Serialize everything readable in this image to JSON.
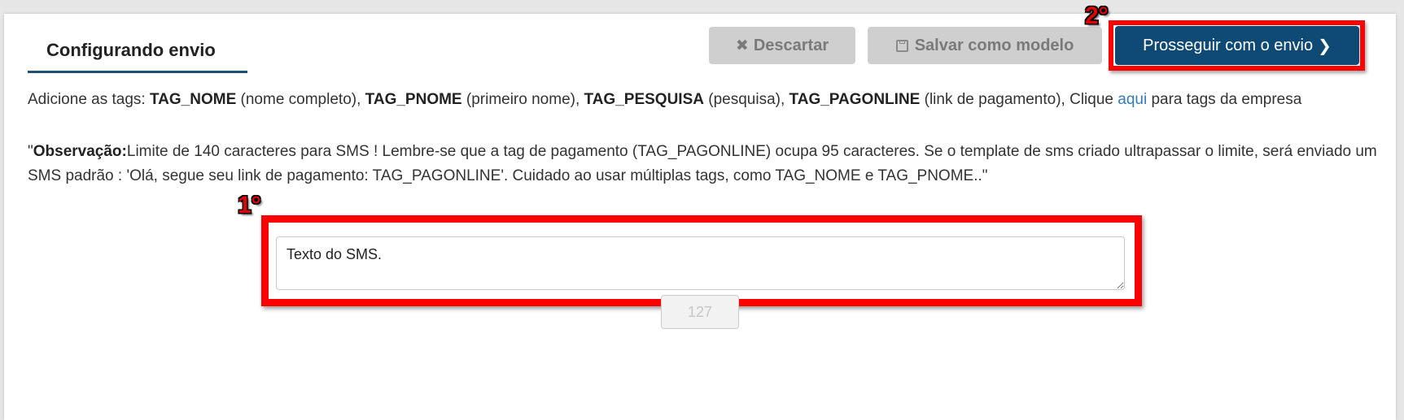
{
  "header": {
    "tab_title": "Configurando envio",
    "discard_label": "Descartar",
    "save_template_label": "Salvar como modelo",
    "proceed_label": "Prosseguir com o envio"
  },
  "annotations": {
    "step_1": "1°",
    "step_2": "2°",
    "highlight_color": "#ff0000"
  },
  "tags_line": {
    "prefix": "Adicione as tags: ",
    "tag1": "TAG_NOME",
    "tag1_desc": " (nome completo), ",
    "tag2": "TAG_PNOME",
    "tag2_desc": " (primeiro nome), ",
    "tag3": "TAG_PESQUISA",
    "tag3_desc": " (pesquisa), ",
    "tag4": "TAG_PAGONLINE",
    "tag4_desc": " (link de pagamento), Clique ",
    "link": "aqui",
    "suffix": " para tags da empresa"
  },
  "note": {
    "quote_open": "\"",
    "label": "Observação:",
    "text": "Limite de 140 caracteres para SMS ! Lembre-se que a tag de pagamento (TAG_PAGONLINE) ocupa 95 caracteres. Se o template de sms criado ultrapassar o limite, será enviado um SMS padrão : 'Olá, segue seu link de pagamento: TAG_PAGONLINE'. Cuidado ao usar múltiplas tags, como TAG_NOME e TAG_PNOME..\""
  },
  "sms": {
    "value": "Texto do SMS.",
    "counter": "127"
  },
  "colors": {
    "primary": "#0f4a74",
    "disabled_button": "#cfcfcf",
    "link": "#337ab7"
  },
  "icons": {
    "discard": "times-icon",
    "save": "floppy-icon",
    "proceed": "chevron-right-icon"
  }
}
